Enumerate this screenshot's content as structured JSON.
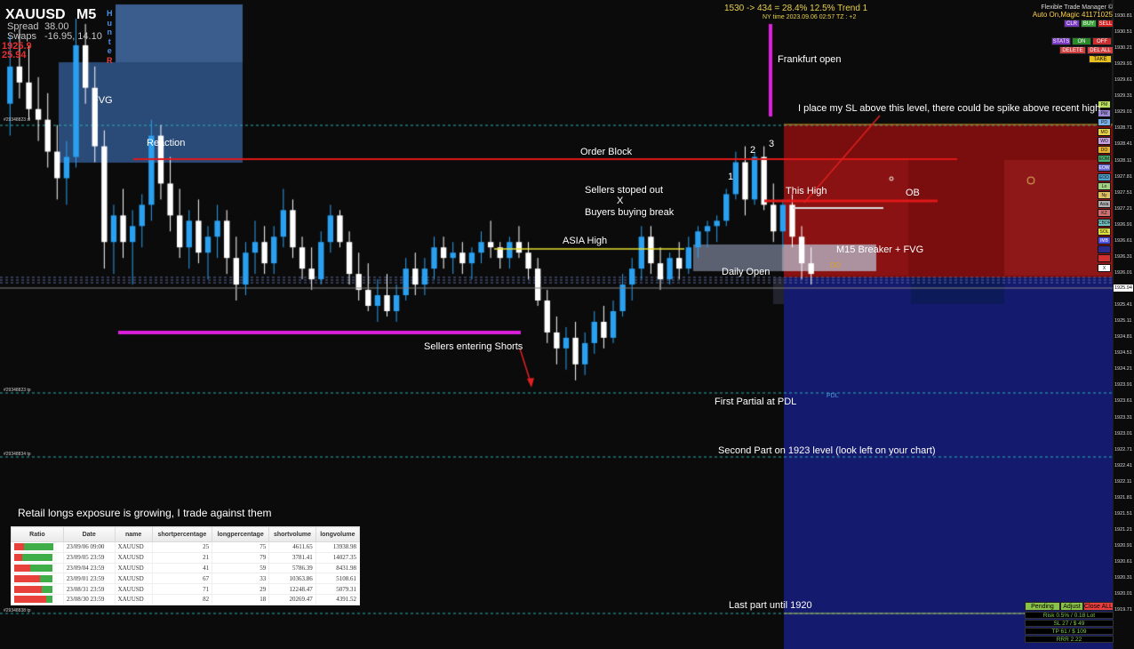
{
  "header": {
    "symbol": "XAUUSD",
    "timeframe": "M5",
    "spread_label": "Spread",
    "spread_value": "38.00",
    "swaps_label": "Swaps",
    "swaps_value": "-16.95, 14.10",
    "price_top": "1925.9",
    "price_bottom": "25.94",
    "hunter_letters": [
      "H",
      "u",
      "n",
      "t",
      "e",
      "R"
    ]
  },
  "top_info": {
    "trade_line": "1530 -> 434 = 28.4%  12.5% Trend 1",
    "time_line": "NY  time 2023.09.06 02:57 TZ : +2"
  },
  "trade_manager": {
    "title": "Flexible Trade Manager ©",
    "status": "Auto On,Magic 41171025",
    "buttons_row1": [
      {
        "label": "CLR",
        "color": "#7a3ac0"
      },
      {
        "label": "BUY",
        "color": "#3aa03a"
      },
      {
        "label": "SELL",
        "color": "#d02020"
      }
    ],
    "buttons_row2": [
      {
        "label": "STATS",
        "color": "#7a3ac0"
      },
      {
        "label": "ON",
        "color": "#2a8a2a"
      },
      {
        "label": "OFF",
        "color": "#c83030"
      }
    ],
    "buttons_row3": [
      {
        "label": "DELETE",
        "color": "#d04040"
      },
      {
        "label": "DEL ALL",
        "color": "#d04040"
      }
    ],
    "buttons_row4": [
      {
        "label": "TAKE ORDER",
        "color": "#e6c020"
      }
    ]
  },
  "side_buttons": [
    {
      "label": "PM",
      "color": "#b8e05a"
    },
    {
      "label": "PW",
      "color": "#9a8ad8"
    },
    {
      "label": "PD",
      "color": "#7ab0e8"
    },
    {
      "label": "MO",
      "color": "#e8d24a"
    },
    {
      "label": "WO",
      "color": "#c8a0e0"
    },
    {
      "label": "DO",
      "color": "#e8b030"
    },
    {
      "label": "EOM",
      "color": "#4ab070"
    },
    {
      "label": "EOW",
      "color": "#6a6ad0"
    },
    {
      "label": "EOD",
      "color": "#50a0d0"
    },
    {
      "label": "Lo",
      "color": "#a0d080"
    },
    {
      "label": "Ny",
      "color": "#e0c060"
    },
    {
      "label": "Asia",
      "color": "#b0b0b0"
    },
    {
      "label": "KZ",
      "color": "#d07070"
    },
    {
      "label": "CBDR",
      "color": "#70c0c0"
    },
    {
      "label": "SOL",
      "color": "#e0e040"
    },
    {
      "label": "IMB",
      "color": "#5050e0"
    },
    {
      "label": "",
      "color": "#2a2a8a"
    },
    {
      "label": "",
      "color": "#d03030"
    },
    {
      "label": "X",
      "color": "#ffffff"
    }
  ],
  "price_axis": [
    "1930.81",
    "1930.51",
    "1930.21",
    "1929.91",
    "1929.61",
    "1929.31",
    "1929.01",
    "1928.71",
    "1928.41",
    "1928.11",
    "1927.81",
    "1927.51",
    "1927.21",
    "1926.91",
    "1926.61",
    "1926.31",
    "1926.01",
    "1925.71",
    "1925.41",
    "1925.11",
    "1924.81",
    "1924.51",
    "1924.21",
    "1923.91",
    "1923.61",
    "1923.31",
    "1923.01",
    "1922.71",
    "1922.41",
    "1922.11",
    "1921.81",
    "1921.51",
    "1921.21",
    "1920.91",
    "1920.61",
    "1920.31",
    "1920.01",
    "1919.71"
  ],
  "current_price": "1925.94",
  "annotations": {
    "fvg": "FVG",
    "reaction": "Reaction",
    "frankfurt": "Frankfurt open",
    "sl_note": "I place my SL above this level, there could be spike above recent high",
    "order_block": "Order Block",
    "num1": "1",
    "num2": "2",
    "num3": "3",
    "this_high": "This High",
    "ob": "OB",
    "sellers_out": "Sellers stoped out",
    "x_mark": "X",
    "buyers_break": "Buyers buying break",
    "asia_high": "ASIA High",
    "m15_breaker": "M15 Breaker + FVG",
    "do_label": "DO",
    "daily_open": "Daily Open",
    "sellers_entering": "Sellers entering Shorts",
    "first_partial": "First Partial at PDL",
    "pdl": "PDL",
    "second_part": "Second Part on 1923 level (look left on your chart)",
    "last_part": "Last part until 1920",
    "retail_note": "Retail longs exposure is growing, I trade against them"
  },
  "left_tags": {
    "tag1": "#29348823 sl",
    "tag2": "#29348823 tp",
    "tag3": "#29348834 tp",
    "tag4": "#29348838 tp"
  },
  "sentiment_table": {
    "columns": [
      "Ratio",
      "Date",
      "name",
      "shortpercentage",
      "longpercentage",
      "shortvolume",
      "longvolume"
    ],
    "rows": [
      {
        "date": "23/09/06 09:00",
        "name": "XAUUSD",
        "short": "25",
        "long": "75",
        "shortvol": "4611.65",
        "longvol": "13938.98"
      },
      {
        "date": "23/09/05 23:59",
        "name": "XAUUSD",
        "short": "21",
        "long": "79",
        "shortvol": "3781.41",
        "longvol": "14027.35"
      },
      {
        "date": "23/09/04 23:59",
        "name": "XAUUSD",
        "short": "41",
        "long": "59",
        "shortvol": "5786.39",
        "longvol": "8431.98"
      },
      {
        "date": "23/09/01 23:59",
        "name": "XAUUSD",
        "short": "67",
        "long": "33",
        "shortvol": "10363.86",
        "longvol": "5108.61"
      },
      {
        "date": "23/08/31 23:59",
        "name": "XAUUSD",
        "short": "71",
        "long": "29",
        "shortvol": "12248.47",
        "longvol": "5079.31"
      },
      {
        "date": "23/08/30 23:59",
        "name": "XAUUSD",
        "short": "82",
        "long": "18",
        "shortvol": "20269.47",
        "longvol": "4391.52"
      }
    ]
  },
  "bottom_panel": {
    "pending": "Pending",
    "adjust": "Adjust",
    "close_all": "Close ALL",
    "risk": "Risk 0.5% / 0.18 Lot",
    "sl": "SL 27 / $ 49",
    "tp": "TP 61 / $ 109",
    "rrr": "RRR 2.22"
  },
  "chart_data": {
    "type": "candlestick",
    "symbol": "XAUUSD",
    "timeframe": "M5",
    "ylim": [
      1919.6,
      1930.9
    ],
    "levels": [
      {
        "name": "Order Block",
        "price": 1928.15
      },
      {
        "name": "ASIA High",
        "price": 1926.9
      },
      {
        "name": "Daily Open",
        "price": 1926.55
      },
      {
        "name": "PDL",
        "price": 1924.0
      },
      {
        "name": "Second Part",
        "price": 1923.0
      },
      {
        "name": "Last part",
        "price": 1920.0
      }
    ],
    "candles": [
      [
        1929.2,
        1930.5,
        1928.6,
        1929.9
      ],
      [
        1929.9,
        1930.6,
        1929.3,
        1929.6
      ],
      [
        1929.6,
        1930.3,
        1928.9,
        1929.1
      ],
      [
        1929.1,
        1929.7,
        1928.5,
        1928.9
      ],
      [
        1928.9,
        1929.4,
        1928.0,
        1928.3
      ],
      [
        1928.3,
        1928.8,
        1927.4,
        1927.8
      ],
      [
        1927.8,
        1928.5,
        1927.3,
        1928.2
      ],
      [
        1928.2,
        1930.8,
        1928.0,
        1930.3
      ],
      [
        1930.3,
        1930.7,
        1929.2,
        1929.5
      ],
      [
        1929.5,
        1929.9,
        1928.1,
        1928.4
      ],
      [
        1928.4,
        1928.7,
        1926.1,
        1926.6
      ],
      [
        1926.6,
        1927.3,
        1926.0,
        1927.1
      ],
      [
        1927.1,
        1927.6,
        1926.3,
        1926.6
      ],
      [
        1926.6,
        1927.2,
        1925.8,
        1926.9
      ],
      [
        1926.9,
        1927.5,
        1926.5,
        1927.3
      ],
      [
        1927.3,
        1928.9,
        1927.0,
        1928.6
      ],
      [
        1928.6,
        1928.8,
        1927.4,
        1927.7
      ],
      [
        1927.7,
        1928.2,
        1926.8,
        1927.1
      ],
      [
        1927.1,
        1927.6,
        1926.3,
        1926.5
      ],
      [
        1926.5,
        1927.2,
        1926.1,
        1927.0
      ],
      [
        1927.0,
        1927.4,
        1926.2,
        1926.4
      ],
      [
        1926.4,
        1926.9,
        1925.9,
        1926.7
      ],
      [
        1926.7,
        1927.3,
        1926.3,
        1927.0
      ],
      [
        1927.0,
        1927.2,
        1926.0,
        1926.3
      ],
      [
        1926.3,
        1926.7,
        1925.5,
        1925.8
      ],
      [
        1925.8,
        1926.6,
        1925.6,
        1926.4
      ],
      [
        1926.4,
        1927.0,
        1926.0,
        1926.6
      ],
      [
        1926.6,
        1926.9,
        1926.0,
        1926.2
      ],
      [
        1926.2,
        1926.9,
        1926.0,
        1926.7
      ],
      [
        1926.7,
        1927.6,
        1926.5,
        1927.2
      ],
      [
        1927.2,
        1927.4,
        1926.3,
        1926.5
      ],
      [
        1926.5,
        1926.7,
        1925.9,
        1926.1
      ],
      [
        1926.1,
        1926.5,
        1925.7,
        1925.9
      ],
      [
        1925.9,
        1926.8,
        1925.8,
        1926.6
      ],
      [
        1926.6,
        1927.3,
        1926.4,
        1927.1
      ],
      [
        1927.1,
        1927.2,
        1926.5,
        1926.6
      ],
      [
        1926.6,
        1926.8,
        1925.8,
        1926.0
      ],
      [
        1926.0,
        1926.4,
        1925.5,
        1925.7
      ],
      [
        1925.7,
        1926.2,
        1925.3,
        1925.4
      ],
      [
        1925.4,
        1925.9,
        1925.1,
        1925.6
      ],
      [
        1925.6,
        1926.0,
        1925.2,
        1925.3
      ],
      [
        1925.3,
        1925.8,
        1925.1,
        1925.6
      ],
      [
        1925.6,
        1926.3,
        1925.5,
        1926.1
      ],
      [
        1926.1,
        1926.4,
        1925.6,
        1925.8
      ],
      [
        1925.8,
        1926.3,
        1925.6,
        1926.1
      ],
      [
        1926.1,
        1926.7,
        1925.9,
        1926.5
      ],
      [
        1926.5,
        1926.7,
        1926.1,
        1926.3
      ],
      [
        1926.3,
        1926.6,
        1926.0,
        1926.4
      ],
      [
        1926.4,
        1926.6,
        1926.0,
        1926.2
      ],
      [
        1926.2,
        1926.5,
        1925.9,
        1926.4
      ],
      [
        1926.4,
        1926.8,
        1926.2,
        1926.6
      ],
      [
        1926.6,
        1927.0,
        1926.3,
        1926.5
      ],
      [
        1926.5,
        1926.6,
        1926.1,
        1926.3
      ],
      [
        1926.3,
        1926.7,
        1926.1,
        1926.6
      ],
      [
        1926.6,
        1926.9,
        1926.3,
        1926.4
      ],
      [
        1926.4,
        1926.6,
        1925.9,
        1926.1
      ],
      [
        1926.1,
        1926.3,
        1925.4,
        1925.5
      ],
      [
        1925.5,
        1925.7,
        1924.7,
        1924.9
      ],
      [
        1924.9,
        1925.2,
        1924.3,
        1924.6
      ],
      [
        1924.6,
        1925.0,
        1924.2,
        1924.8
      ],
      [
        1924.8,
        1925.1,
        1924.0,
        1924.3
      ],
      [
        1924.3,
        1924.9,
        1924.1,
        1924.7
      ],
      [
        1924.7,
        1925.3,
        1924.5,
        1925.1
      ],
      [
        1925.1,
        1925.4,
        1924.6,
        1924.8
      ],
      [
        1924.8,
        1925.5,
        1924.7,
        1925.3
      ],
      [
        1925.3,
        1926.0,
        1925.2,
        1925.8
      ],
      [
        1925.8,
        1926.3,
        1925.5,
        1926.1
      ],
      [
        1926.1,
        1926.9,
        1925.9,
        1926.7
      ],
      [
        1926.7,
        1926.9,
        1926.0,
        1926.2
      ],
      [
        1926.2,
        1926.5,
        1925.7,
        1925.9
      ],
      [
        1925.9,
        1926.4,
        1925.8,
        1926.3
      ],
      [
        1926.3,
        1926.6,
        1925.9,
        1926.1
      ],
      [
        1926.1,
        1926.7,
        1926.0,
        1926.5
      ],
      [
        1926.5,
        1926.9,
        1926.3,
        1926.8
      ],
      [
        1926.8,
        1927.0,
        1926.5,
        1926.9
      ],
      [
        1926.9,
        1927.1,
        1926.6,
        1927.0
      ],
      [
        1927.0,
        1927.6,
        1926.9,
        1927.5
      ],
      [
        1927.5,
        1928.3,
        1927.4,
        1928.1
      ],
      [
        1928.1,
        1928.4,
        1927.1,
        1927.4
      ],
      [
        1927.4,
        1928.3,
        1927.3,
        1928.2
      ],
      [
        1928.2,
        1928.4,
        1927.2,
        1927.3
      ],
      [
        1927.3,
        1927.7,
        1926.6,
        1926.8
      ],
      [
        1926.8,
        1927.4,
        1926.5,
        1927.3
      ],
      [
        1927.3,
        1927.5,
        1926.5,
        1926.7
      ],
      [
        1926.7,
        1926.9,
        1925.9,
        1926.2
      ],
      [
        1926.2,
        1926.5,
        1925.8,
        1926.0
      ]
    ]
  }
}
